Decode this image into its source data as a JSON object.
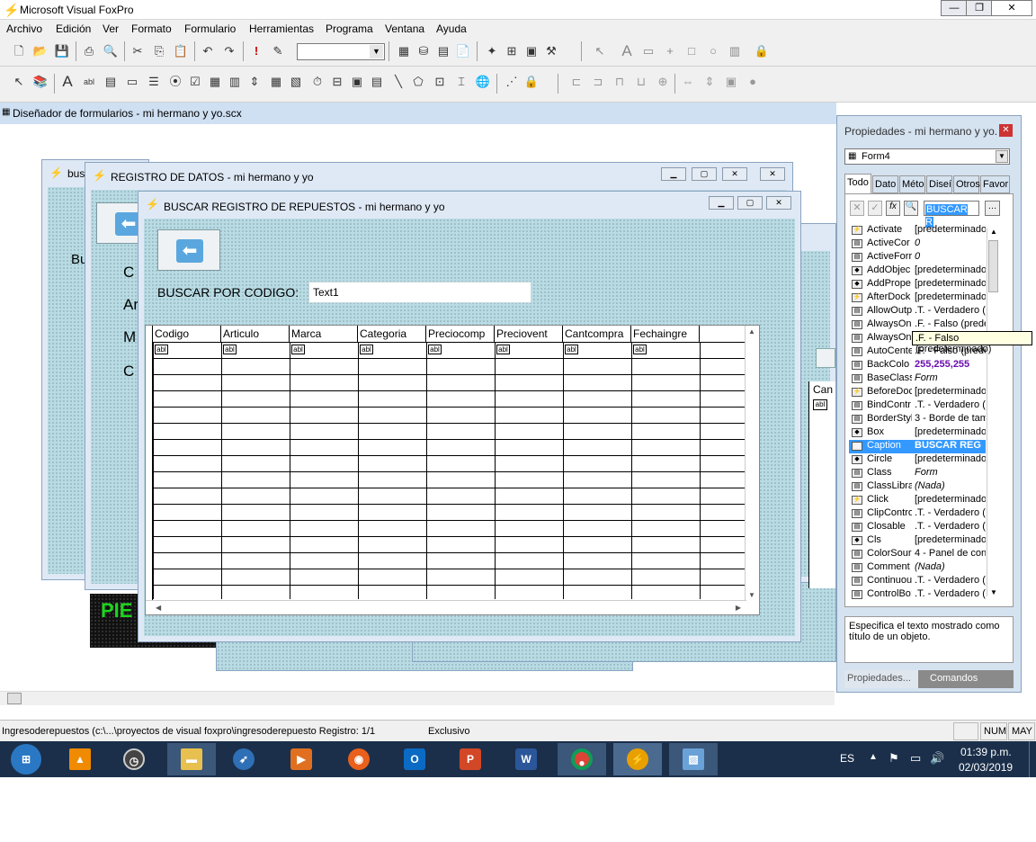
{
  "app": {
    "title": "Microsoft Visual FoxPro"
  },
  "menu": [
    "Archivo",
    "Edición",
    "Ver",
    "Formato",
    "Formulario",
    "Herramientas",
    "Programa",
    "Ventana",
    "Ayuda"
  ],
  "designer": {
    "title": "Diseñador de formularios - mi hermano y yo.scx"
  },
  "back_form": {
    "title": "bus",
    "partial_label": "Bu"
  },
  "registro_form": {
    "title": "REGISTRO DE DATOS  - mi hermano y yo",
    "labels": [
      "C",
      "Ar",
      "M",
      "C"
    ]
  },
  "buscar_form": {
    "title": "BUSCAR REGISTRO DE REPUESTOS - mi hermano y yo",
    "search_label": "BUSCAR POR CODIGO:",
    "search_value": "Text1",
    "columns": [
      "Codigo",
      "Articulo",
      "Marca",
      "Categoria",
      "Preciocomp",
      "Preciovent",
      "Cantcompra",
      "Fechaingre"
    ],
    "cell_placeholder": "abl"
  },
  "right_fragment": {
    "label": "Can",
    "cell": "abl"
  },
  "footer_fragment": {
    "text": "PIE"
  },
  "properties": {
    "title": "Propiedades - mi hermano y yo.",
    "object": "Form4",
    "tabs": [
      "Todo",
      "Dato",
      "Méto",
      "Diseí",
      "Otros",
      "Favor"
    ],
    "edit_value": "BUSCAR R",
    "rows": [
      {
        "name": "Activate",
        "value": "[predeterminado]",
        "icon": "event"
      },
      {
        "name": "ActiveCor",
        "value": "0",
        "icon": "prop"
      },
      {
        "name": "ActiveForr",
        "value": "0",
        "icon": "prop"
      },
      {
        "name": "AddObjec",
        "value": "[predeterminado]",
        "icon": "method"
      },
      {
        "name": "AddPrope",
        "value": "[predeterminado]",
        "icon": "method"
      },
      {
        "name": "AfterDock",
        "value": "[predeterminado]",
        "icon": "event"
      },
      {
        "name": "AllowOutp",
        "value": ".T. - Verdadero (p",
        "icon": "prop"
      },
      {
        "name": "AlwaysOn",
        "value": ".F. - Falso (prede",
        "icon": "prop"
      },
      {
        "name": "AlwaysOn",
        "value": ".F. - Falso (prede",
        "icon": "prop"
      },
      {
        "name": "AutoCente",
        "value": ".F. - Falso (prede",
        "icon": "prop"
      },
      {
        "name": "BackColo",
        "value": "255,255,255",
        "icon": "prop"
      },
      {
        "name": "BaseClass",
        "value": "Form",
        "icon": "prop"
      },
      {
        "name": "BeforeDoc",
        "value": "[predeterminado]",
        "icon": "event"
      },
      {
        "name": "BindContr",
        "value": ".T. - Verdadero (p",
        "icon": "prop"
      },
      {
        "name": "BorderStyl",
        "value": "3 - Borde de tam",
        "icon": "prop"
      },
      {
        "name": "Box",
        "value": "[predeterminado]",
        "icon": "method"
      },
      {
        "name": "Caption",
        "value": "BUSCAR REG",
        "icon": "prop"
      },
      {
        "name": "Circle",
        "value": "[predeterminado]",
        "icon": "method"
      },
      {
        "name": "Class",
        "value": "Form",
        "icon": "prop"
      },
      {
        "name": "ClassLibra",
        "value": "(Nada)",
        "icon": "prop"
      },
      {
        "name": "Click",
        "value": "[predeterminado]",
        "icon": "event"
      },
      {
        "name": "ClipContro",
        "value": ".T. - Verdadero (p",
        "icon": "prop"
      },
      {
        "name": "Closable",
        "value": ".T. - Verdadero (p",
        "icon": "prop"
      },
      {
        "name": "Cls",
        "value": "[predeterminado]",
        "icon": "method"
      },
      {
        "name": "ColorSourc",
        "value": "4 - Panel de con",
        "icon": "prop"
      },
      {
        "name": "Comment",
        "value": "(Nada)",
        "icon": "prop"
      },
      {
        "name": "Continuou",
        "value": ".T. - Verdadero (p",
        "icon": "prop"
      },
      {
        "name": "ControlBo:",
        "value": ".T. - Verdadero (p",
        "icon": "prop"
      }
    ],
    "selected_row": 16,
    "tooltip": ".F. - Falso (predeterminado)",
    "description": "Especifica el texto mostrado como título de un objeto.",
    "bottom_tabs": [
      "Propiedades...",
      "Comandos"
    ]
  },
  "status": {
    "path": "Ingresoderepuestos (c:\\...\\proyectos de visual foxpro\\ingresoderepuesto Registro: 1/1",
    "mode": "Exclusivo",
    "num": "NUM",
    "caps": "MAY"
  },
  "taskbar": {
    "lang": "ES",
    "time": "01:39 p.m.",
    "date": "02/03/2019",
    "apps": [
      "start-button",
      "vlc-icon",
      "clock-icon",
      "explorer-icon",
      "rocket-icon",
      "media-icon",
      "firefox-icon",
      "outlook-icon",
      "powerpoint-icon",
      "word-icon",
      "chrome-icon",
      "foxpro-icon",
      "picture-icon"
    ]
  },
  "colors": {
    "accent": "#3399ff",
    "form_bg": "#b9dbe4",
    "taskbar": "#1b2f4a"
  }
}
